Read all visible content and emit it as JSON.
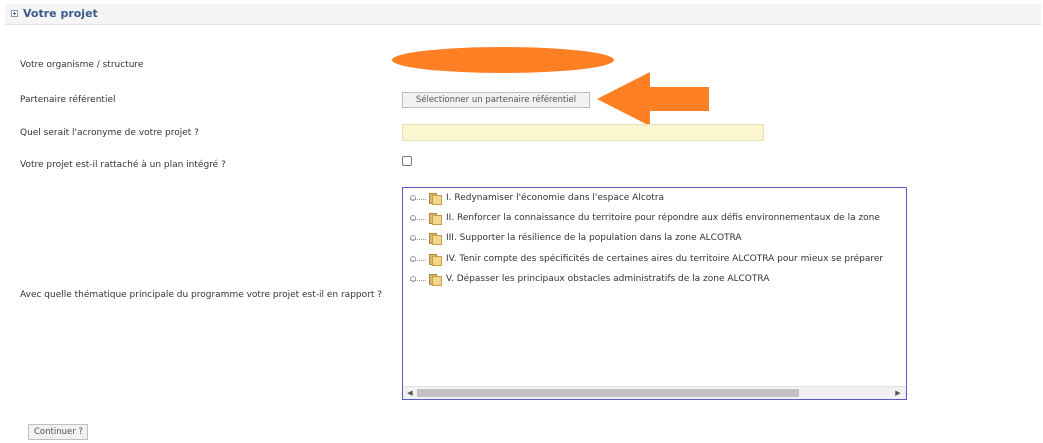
{
  "section": {
    "title": "Votre projet"
  },
  "form": {
    "organization_label": "Votre organisme / structure",
    "partner_label": "Partenaire référentiel",
    "partner_button": "Sélectionner un partenaire référentiel",
    "acronym_label": "Quel serait l'acronyme de votre projet ?",
    "acronym_value": "",
    "integrated_plan_label": "Votre projet est-il rattaché à un plan intégré ?",
    "integrated_plan_checked": false,
    "theme_label": "Avec quelle thématique principale du programme votre projet est-il en rapport ?",
    "themes": [
      "I. Redynamiser l'économie dans l'espace Alcotra",
      "II. Renforcer la connaissance du territoire pour répondre aux défis environnementaux de la zone",
      "III. Supporter la résilience de la population dans la zone ALCOTRA",
      "IV. Tenir compte des spécificités de certaines aires du territoire ALCOTRA pour mieux se préparer",
      "V. Dépasser les principaux obstacles administratifs de la zone ALCOTRA"
    ],
    "continue_button": "Continuer ?"
  },
  "annotations": {
    "arrow_color": "#ff8024",
    "redaction_color": "#ff8024"
  }
}
